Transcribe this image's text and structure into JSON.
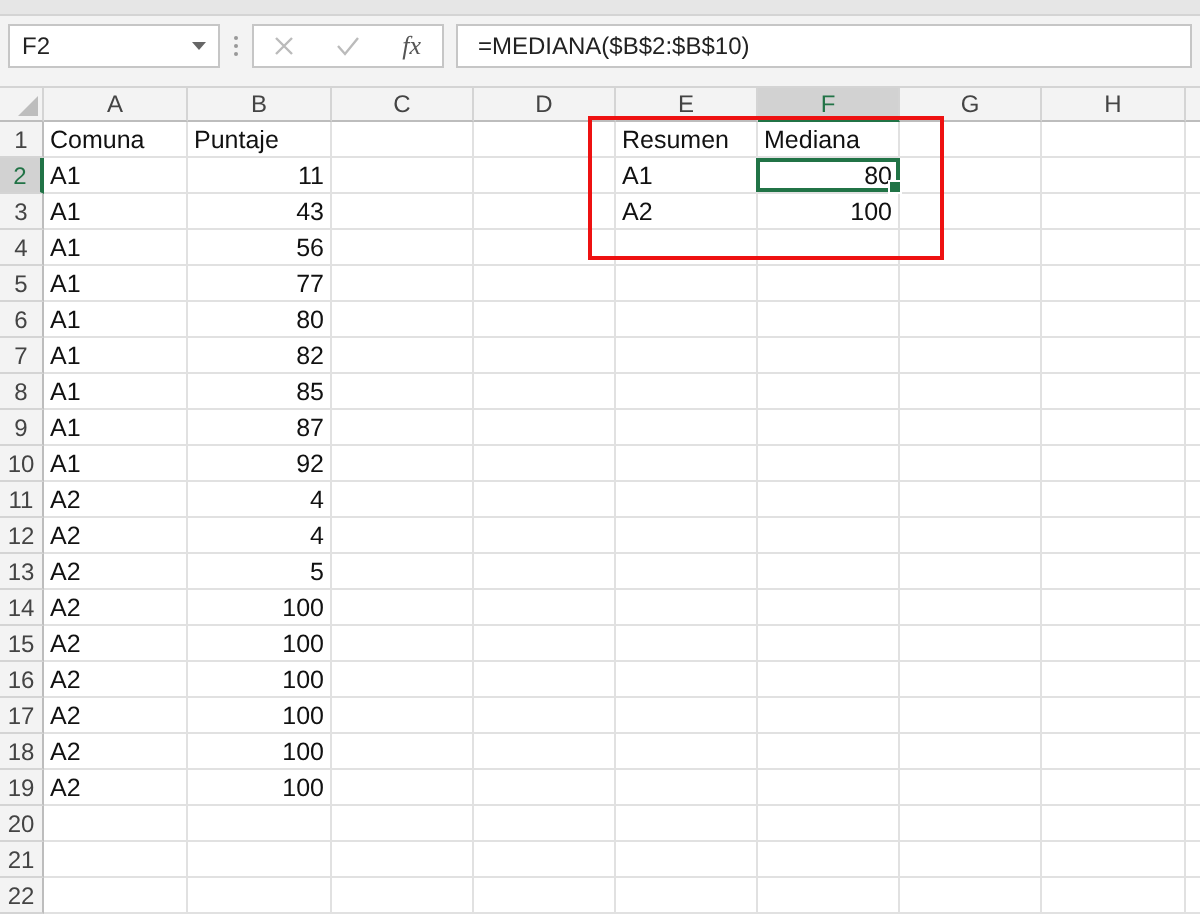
{
  "name_box": "F2",
  "fx": "fx",
  "formula": "=MEDIANA($B$2:$B$10)",
  "columns": [
    {
      "label": "A",
      "selected": false
    },
    {
      "label": "B",
      "selected": false
    },
    {
      "label": "C",
      "selected": false
    },
    {
      "label": "D",
      "selected": false
    },
    {
      "label": "E",
      "selected": false
    },
    {
      "label": "F",
      "selected": true
    },
    {
      "label": "G",
      "selected": false
    },
    {
      "label": "H",
      "selected": false
    }
  ],
  "rows": [
    {
      "label": "1",
      "selected": false,
      "cells": [
        {
          "kind": "text",
          "text": "Comuna",
          "selected": false
        },
        {
          "kind": "text",
          "text": "Puntaje",
          "selected": false
        },
        {
          "kind": "empty"
        },
        {
          "kind": "empty"
        },
        {
          "kind": "text",
          "text": "Resumen",
          "selected": false
        },
        {
          "kind": "text",
          "text": "Mediana",
          "selected": false
        }
      ]
    },
    {
      "label": "2",
      "selected": true,
      "cells": [
        {
          "kind": "text",
          "text": "A1",
          "selected": false
        },
        {
          "kind": "number",
          "text": "11",
          "selected": false
        },
        {
          "kind": "empty"
        },
        {
          "kind": "empty"
        },
        {
          "kind": "text",
          "text": "A1",
          "selected": false
        },
        {
          "kind": "number",
          "text": "80",
          "selected": true
        }
      ]
    },
    {
      "label": "3",
      "selected": false,
      "cells": [
        {
          "kind": "text",
          "text": "A1",
          "selected": false
        },
        {
          "kind": "number",
          "text": "43",
          "selected": false
        },
        {
          "kind": "empty"
        },
        {
          "kind": "empty"
        },
        {
          "kind": "text",
          "text": "A2",
          "selected": false
        },
        {
          "kind": "number",
          "text": "100",
          "selected": false
        }
      ]
    },
    {
      "label": "4",
      "selected": false,
      "cells": [
        {
          "kind": "text",
          "text": "A1",
          "selected": false
        },
        {
          "kind": "number",
          "text": "56",
          "selected": false
        }
      ]
    },
    {
      "label": "5",
      "selected": false,
      "cells": [
        {
          "kind": "text",
          "text": "A1",
          "selected": false
        },
        {
          "kind": "number",
          "text": "77",
          "selected": false
        }
      ]
    },
    {
      "label": "6",
      "selected": false,
      "cells": [
        {
          "kind": "text",
          "text": "A1",
          "selected": false
        },
        {
          "kind": "number",
          "text": "80",
          "selected": false
        }
      ]
    },
    {
      "label": "7",
      "selected": false,
      "cells": [
        {
          "kind": "text",
          "text": "A1",
          "selected": false
        },
        {
          "kind": "number",
          "text": "82",
          "selected": false
        }
      ]
    },
    {
      "label": "8",
      "selected": false,
      "cells": [
        {
          "kind": "text",
          "text": "A1",
          "selected": false
        },
        {
          "kind": "number",
          "text": "85",
          "selected": false
        }
      ]
    },
    {
      "label": "9",
      "selected": false,
      "cells": [
        {
          "kind": "text",
          "text": "A1",
          "selected": false
        },
        {
          "kind": "number",
          "text": "87",
          "selected": false
        }
      ]
    },
    {
      "label": "10",
      "selected": false,
      "cells": [
        {
          "kind": "text",
          "text": "A1",
          "selected": false
        },
        {
          "kind": "number",
          "text": "92",
          "selected": false
        }
      ]
    },
    {
      "label": "11",
      "selected": false,
      "cells": [
        {
          "kind": "text",
          "text": "A2",
          "selected": false
        },
        {
          "kind": "number",
          "text": "4",
          "selected": false
        }
      ]
    },
    {
      "label": "12",
      "selected": false,
      "cells": [
        {
          "kind": "text",
          "text": "A2",
          "selected": false
        },
        {
          "kind": "number",
          "text": "4",
          "selected": false
        }
      ]
    },
    {
      "label": "13",
      "selected": false,
      "cells": [
        {
          "kind": "text",
          "text": "A2",
          "selected": false
        },
        {
          "kind": "number",
          "text": "5",
          "selected": false
        }
      ]
    },
    {
      "label": "14",
      "selected": false,
      "cells": [
        {
          "kind": "text",
          "text": "A2",
          "selected": false
        },
        {
          "kind": "number",
          "text": "100",
          "selected": false
        }
      ]
    },
    {
      "label": "15",
      "selected": false,
      "cells": [
        {
          "kind": "text",
          "text": "A2",
          "selected": false
        },
        {
          "kind": "number",
          "text": "100",
          "selected": false
        }
      ]
    },
    {
      "label": "16",
      "selected": false,
      "cells": [
        {
          "kind": "text",
          "text": "A2",
          "selected": false
        },
        {
          "kind": "number",
          "text": "100",
          "selected": false
        }
      ]
    },
    {
      "label": "17",
      "selected": false,
      "cells": [
        {
          "kind": "text",
          "text": "A2",
          "selected": false
        },
        {
          "kind": "number",
          "text": "100",
          "selected": false
        }
      ]
    },
    {
      "label": "18",
      "selected": false,
      "cells": [
        {
          "kind": "text",
          "text": "A2",
          "selected": false
        },
        {
          "kind": "number",
          "text": "100",
          "selected": false
        }
      ]
    },
    {
      "label": "19",
      "selected": false,
      "cells": [
        {
          "kind": "text",
          "text": "A2",
          "selected": false
        },
        {
          "kind": "number",
          "text": "100",
          "selected": false
        }
      ]
    },
    {
      "label": "20",
      "selected": false,
      "cells": []
    },
    {
      "label": "21",
      "selected": false,
      "cells": []
    },
    {
      "label": "22",
      "selected": false,
      "cells": []
    }
  ]
}
